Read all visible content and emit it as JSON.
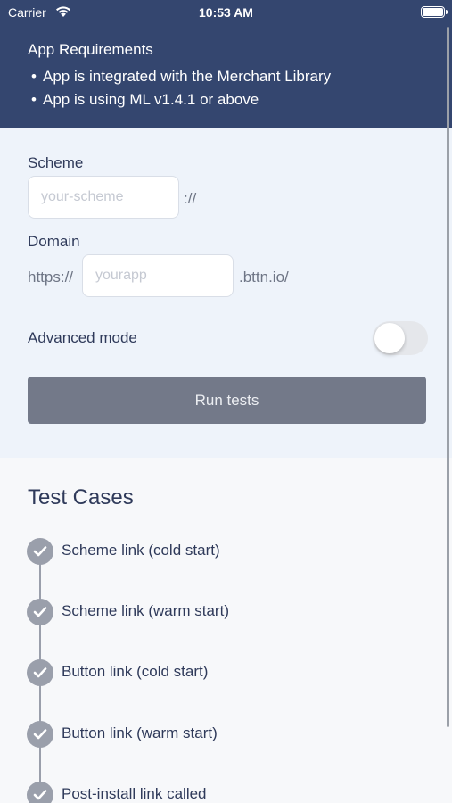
{
  "status_bar": {
    "carrier": "Carrier",
    "time": "10:53 AM"
  },
  "requirements": {
    "title": "App Requirements",
    "items": [
      "App is integrated with the Merchant Library",
      "App is using ML v1.4.1 or above"
    ]
  },
  "form": {
    "scheme_label": "Scheme",
    "scheme_placeholder": "your-scheme",
    "scheme_suffix": "://",
    "domain_label": "Domain",
    "domain_prefix": "https://",
    "domain_placeholder": "yourapp",
    "domain_suffix": ".bttn.io/",
    "advanced_label": "Advanced mode",
    "advanced_on": false,
    "run_button": "Run tests"
  },
  "test_cases": {
    "title": "Test Cases",
    "items": [
      "Scheme link (cold start)",
      "Scheme link (warm start)",
      "Button link (cold start)",
      "Button link (warm start)",
      "Post-install link called"
    ]
  },
  "colors": {
    "header_bg": "#34466f",
    "form_bg": "#eef3fa",
    "button_bg": "#737989",
    "check_bg": "#9a9fab",
    "text": "#2f3a5a"
  }
}
